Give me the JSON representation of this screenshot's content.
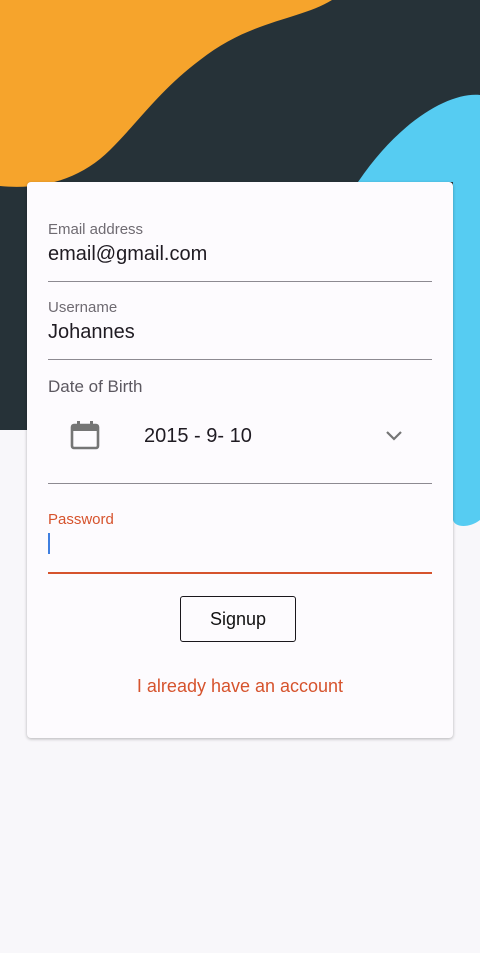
{
  "theme": {
    "orange": "#f6a42c",
    "dark": "#263238",
    "blue": "#56ccf2",
    "accent": "#d6532d"
  },
  "form": {
    "email": {
      "label": "Email address",
      "value": "email@gmail.com"
    },
    "username": {
      "label": "Username",
      "value": "Johannes"
    },
    "dob": {
      "label": "Date of Birth",
      "value": "2015 - 9- 10",
      "icon": "calendar-icon",
      "dropdown_icon": "chevron-down-icon"
    },
    "password": {
      "label": "Password",
      "value": ""
    },
    "signup_label": "Signup",
    "login_link": "I already have an account"
  }
}
